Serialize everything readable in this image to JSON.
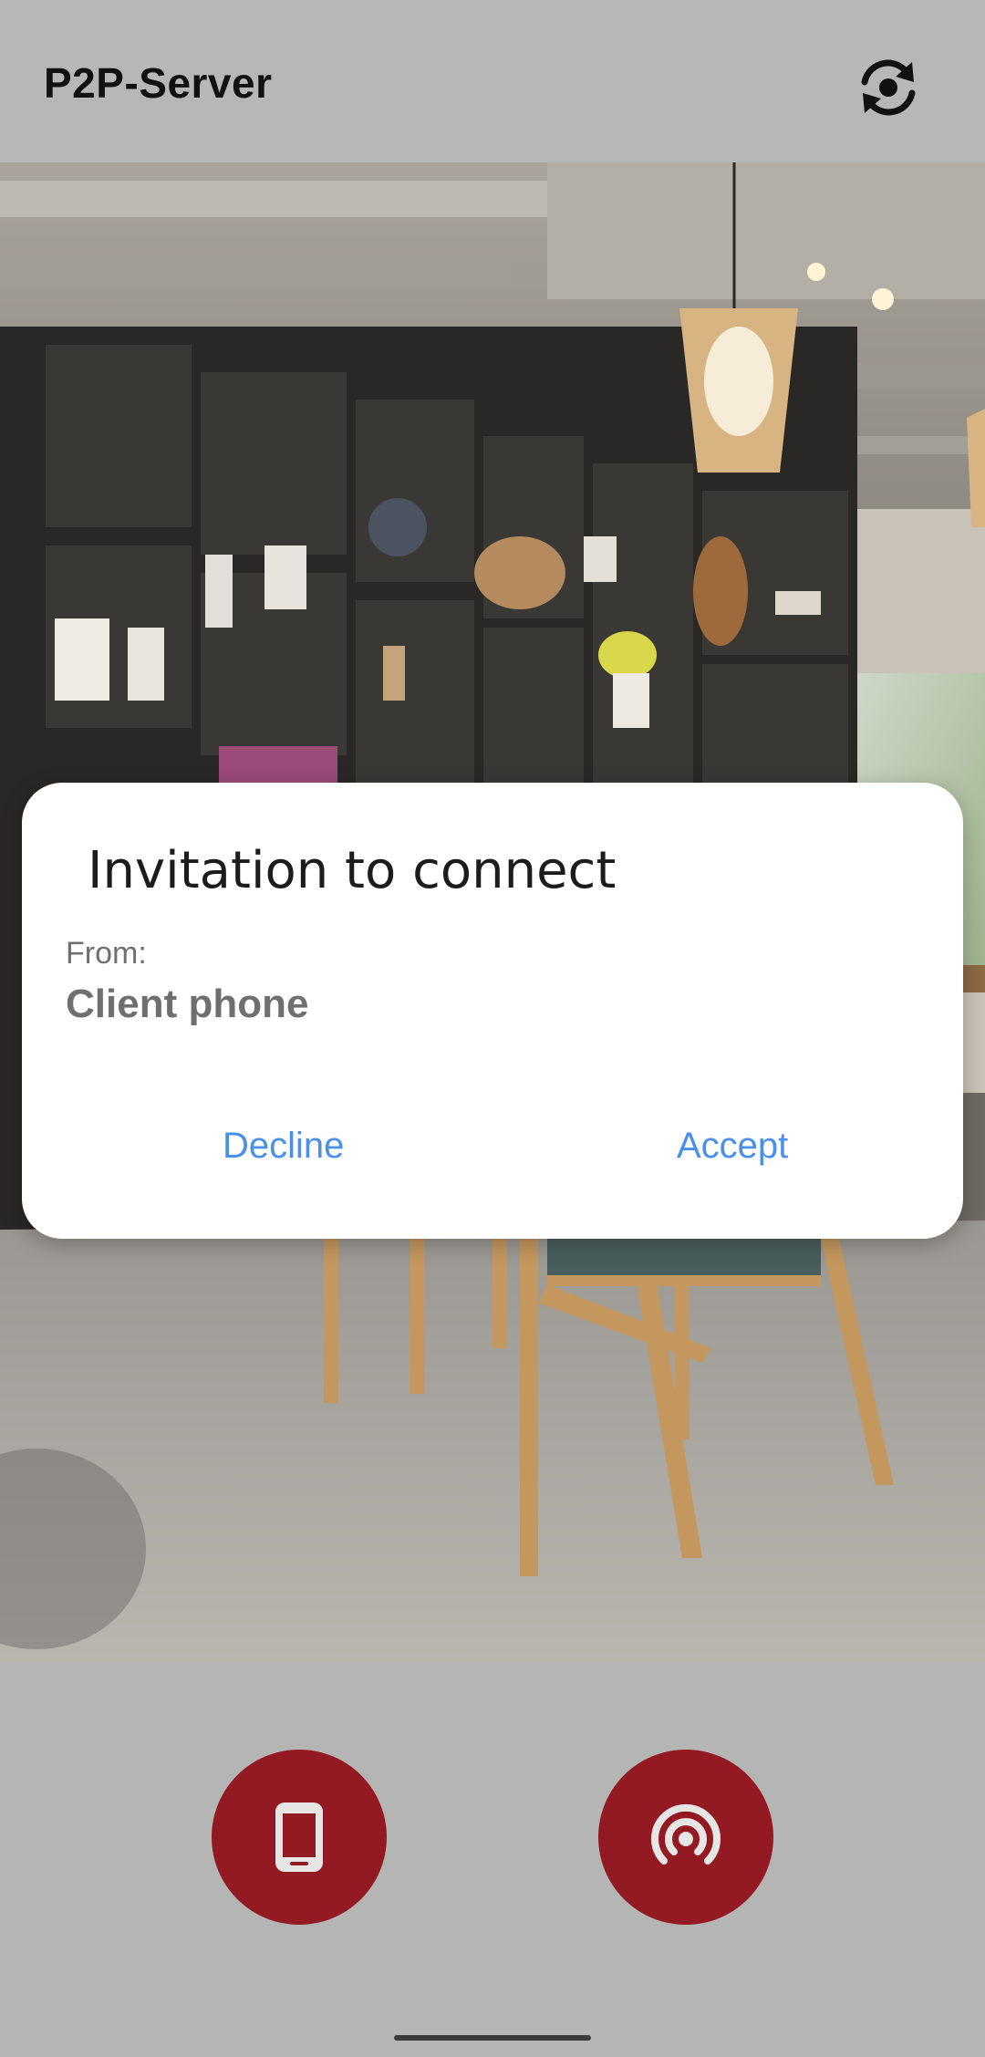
{
  "app_bar": {
    "title": "P2P-Server",
    "action_icon": "switch-camera-icon"
  },
  "dialog": {
    "title": "Invitation to connect",
    "from_label": "From:",
    "from_value": "Client phone",
    "decline_label": "Decline",
    "accept_label": "Accept"
  },
  "bottom_controls": {
    "left_icon": "smartphone-icon",
    "right_icon": "broadcast-icon"
  },
  "colors": {
    "fab": "#931a22",
    "dialog_button": "#4a90e8",
    "app_bar": "#b7b7b7"
  }
}
